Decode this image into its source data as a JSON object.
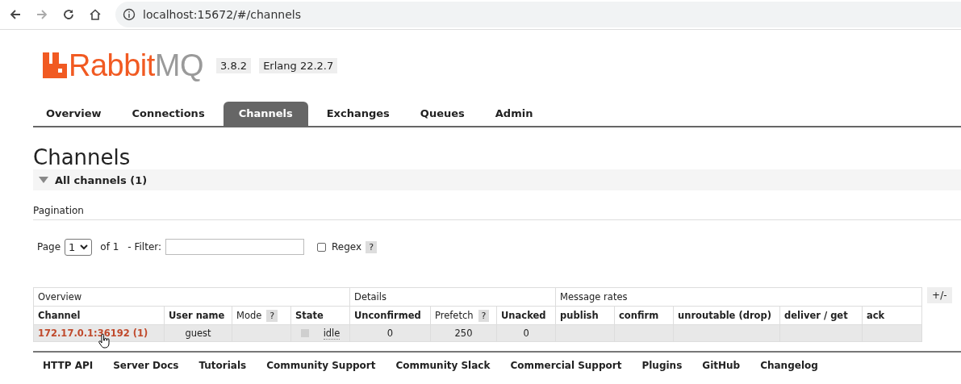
{
  "browser": {
    "url": "localhost:15672/#/channels"
  },
  "header": {
    "logo": "RabbitMQ",
    "version": "3.8.2",
    "erlang": "Erlang 22.2.7"
  },
  "tabs": [
    {
      "label": "Overview",
      "selected": false
    },
    {
      "label": "Connections",
      "selected": false
    },
    {
      "label": "Channels",
      "selected": true
    },
    {
      "label": "Exchanges",
      "selected": false
    },
    {
      "label": "Queues",
      "selected": false
    },
    {
      "label": "Admin",
      "selected": false
    }
  ],
  "page_title": "Channels",
  "section": {
    "title": "All channels (1)",
    "expanded": true
  },
  "pagination": {
    "title": "Pagination",
    "page_label": "Page",
    "page_value": "1",
    "of_label": "of 1",
    "filter_label": "- Filter:",
    "regex_label": "Regex",
    "regex_checked": false,
    "help": "?"
  },
  "table": {
    "groups": [
      {
        "label": "Overview",
        "columns": [
          {
            "label": "Channel",
            "bold": true
          },
          {
            "label": "User name",
            "bold": true
          },
          {
            "label": "Mode",
            "bold": false,
            "help": "?"
          },
          {
            "label": "State",
            "bold": true
          }
        ]
      },
      {
        "label": "Details",
        "columns": [
          {
            "label": "Unconfirmed",
            "bold": true
          },
          {
            "label": "Prefetch",
            "bold": false,
            "help": "?"
          },
          {
            "label": "Unacked",
            "bold": true
          }
        ]
      },
      {
        "label": "Message rates",
        "columns": [
          {
            "label": "publish",
            "bold": true
          },
          {
            "label": "confirm",
            "bold": true
          },
          {
            "label": "unroutable (drop)",
            "bold": true
          },
          {
            "label": "deliver / get",
            "bold": true
          },
          {
            "label": "ack",
            "bold": true
          }
        ]
      }
    ],
    "rows": [
      {
        "channel": "172.17.0.1:36192 (1)",
        "user": "guest",
        "state": "idle",
        "unconfirmed": "0",
        "prefetch": "250",
        "unacked": "0"
      }
    ],
    "toggle": "+/-"
  },
  "footer": [
    "HTTP API",
    "Server Docs",
    "Tutorials",
    "Community Support",
    "Community Slack",
    "Commercial Support",
    "Plugins",
    "GitHub",
    "Changelog"
  ]
}
